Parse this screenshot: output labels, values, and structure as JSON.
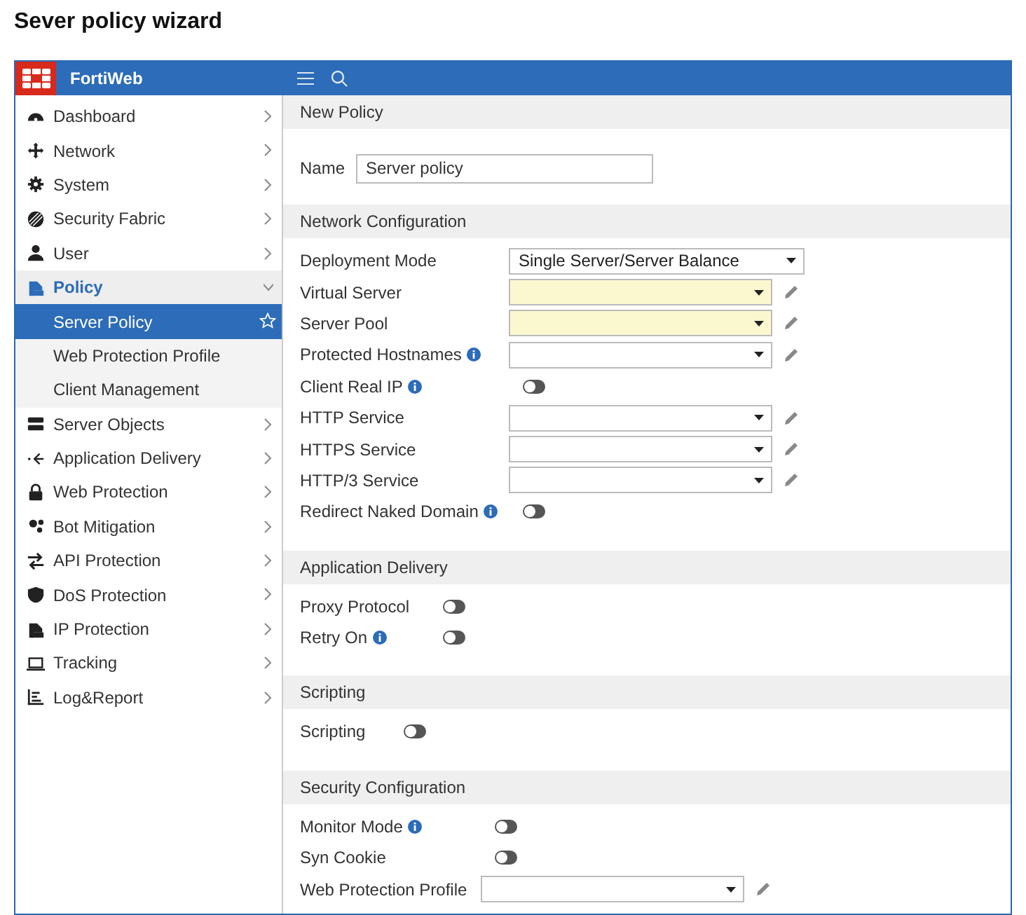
{
  "page_title": "Sever policy wizard",
  "app": {
    "brand": "FortiWeb"
  },
  "sidebar": {
    "items": [
      {
        "label": "Dashboard",
        "expanded": false,
        "selected": false
      },
      {
        "label": "Network",
        "expanded": false,
        "selected": false
      },
      {
        "label": "System",
        "expanded": false,
        "selected": false
      },
      {
        "label": "Security Fabric",
        "expanded": false,
        "selected": false
      },
      {
        "label": "User",
        "expanded": false,
        "selected": false
      },
      {
        "label": "Policy",
        "expanded": true,
        "selected": false,
        "children": [
          {
            "label": "Server Policy",
            "selected": true,
            "favorite": true
          },
          {
            "label": "Web Protection Profile",
            "selected": false,
            "favorite": false
          },
          {
            "label": "Client Management",
            "selected": false,
            "favorite": false
          }
        ]
      },
      {
        "label": "Server Objects",
        "expanded": false,
        "selected": false
      },
      {
        "label": "Application Delivery",
        "expanded": false,
        "selected": false
      },
      {
        "label": "Web Protection",
        "expanded": false,
        "selected": false
      },
      {
        "label": "Bot Mitigation",
        "expanded": false,
        "selected": false
      },
      {
        "label": "API Protection",
        "expanded": false,
        "selected": false
      },
      {
        "label": "DoS Protection",
        "expanded": false,
        "selected": false
      },
      {
        "label": "IP Protection",
        "expanded": false,
        "selected": false
      },
      {
        "label": "Tracking",
        "expanded": false,
        "selected": false
      },
      {
        "label": "Log&Report",
        "expanded": false,
        "selected": false
      }
    ]
  },
  "sections": [
    {
      "title": "New Policy",
      "rows": [
        {
          "kind": "text",
          "label": "Name",
          "value": "Server policy"
        }
      ]
    },
    {
      "title": "Network Configuration",
      "rows": [
        {
          "kind": "select",
          "label": "Deployment Mode",
          "value": "Single Server/Server Balance",
          "required": false,
          "editable": false,
          "info": false
        },
        {
          "kind": "select",
          "label": "Virtual Server",
          "required": true,
          "editable": true,
          "info": false
        },
        {
          "kind": "select",
          "label": "Server Pool",
          "required": true,
          "editable": true,
          "info": false
        },
        {
          "kind": "select",
          "label": "Protected Hostnames",
          "required": false,
          "editable": true,
          "info": true
        },
        {
          "kind": "toggle",
          "label": "Client Real IP",
          "on": false,
          "info": true
        },
        {
          "kind": "select",
          "label": "HTTP Service",
          "required": false,
          "editable": true,
          "info": false
        },
        {
          "kind": "select",
          "label": "HTTPS Service",
          "required": false,
          "editable": true,
          "info": false
        },
        {
          "kind": "select",
          "label": "HTTP/3 Service",
          "required": false,
          "editable": true,
          "info": false
        },
        {
          "kind": "toggle",
          "label": "Redirect Naked Domain",
          "on": false,
          "info": true
        }
      ]
    },
    {
      "title": "Application Delivery",
      "rows": [
        {
          "kind": "toggle",
          "label": "Proxy Protocol",
          "on": false,
          "info": false
        },
        {
          "kind": "toggle",
          "label": "Retry On",
          "on": false,
          "info": true
        }
      ]
    },
    {
      "title": "Scripting",
      "rows": [
        {
          "kind": "toggle",
          "label": "Scripting",
          "on": false,
          "info": false
        }
      ]
    },
    {
      "title": "Security Configuration",
      "rows": [
        {
          "kind": "toggle",
          "label": "Monitor Mode",
          "on": false,
          "info": true
        },
        {
          "kind": "toggle",
          "label": "Syn Cookie",
          "on": false,
          "info": false
        },
        {
          "kind": "select",
          "label": "Web Protection Profile",
          "required": false,
          "editable": true,
          "info": false
        }
      ]
    }
  ]
}
